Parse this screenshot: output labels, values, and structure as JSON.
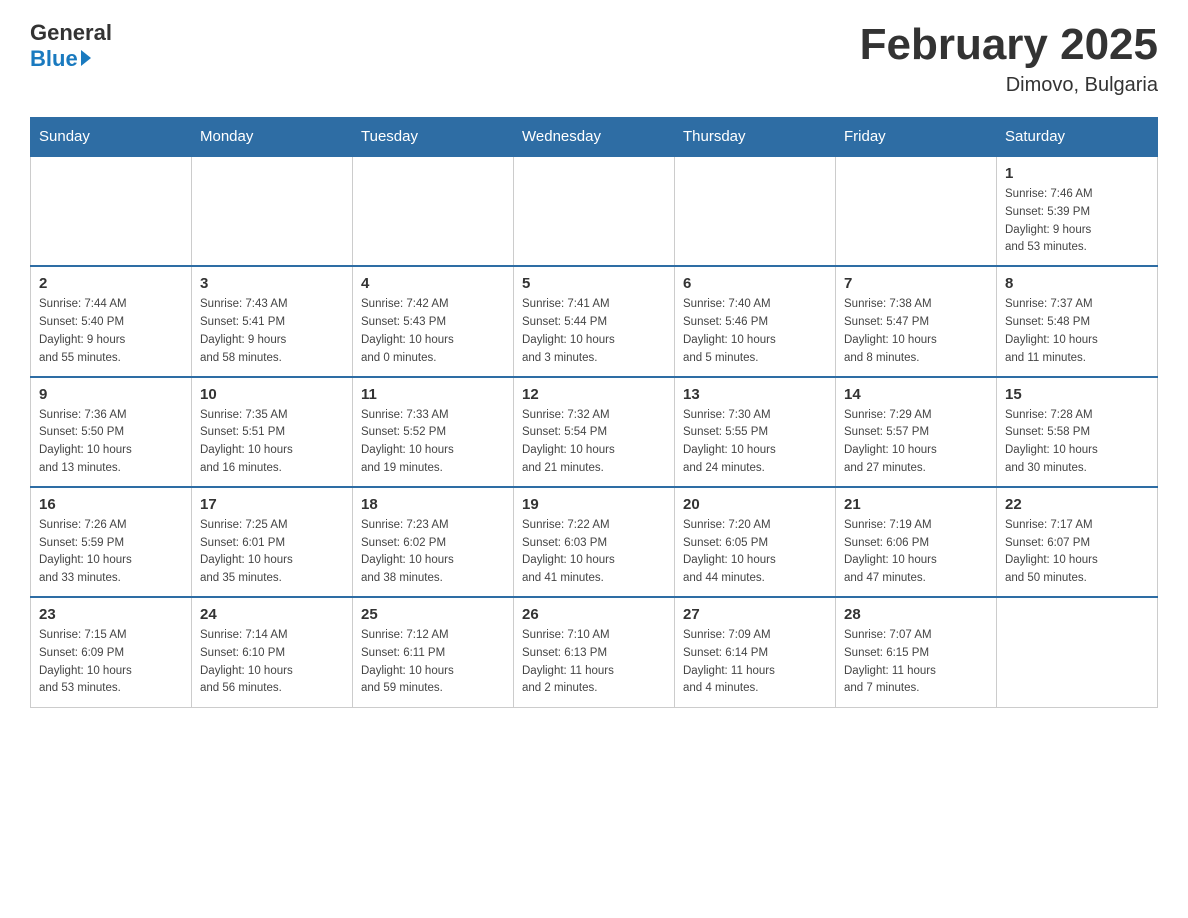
{
  "header": {
    "logo_general": "General",
    "logo_blue": "Blue",
    "month_title": "February 2025",
    "location": "Dimovo, Bulgaria"
  },
  "weekdays": [
    "Sunday",
    "Monday",
    "Tuesday",
    "Wednesday",
    "Thursday",
    "Friday",
    "Saturday"
  ],
  "weeks": [
    [
      {
        "day": "",
        "info": ""
      },
      {
        "day": "",
        "info": ""
      },
      {
        "day": "",
        "info": ""
      },
      {
        "day": "",
        "info": ""
      },
      {
        "day": "",
        "info": ""
      },
      {
        "day": "",
        "info": ""
      },
      {
        "day": "1",
        "info": "Sunrise: 7:46 AM\nSunset: 5:39 PM\nDaylight: 9 hours\nand 53 minutes."
      }
    ],
    [
      {
        "day": "2",
        "info": "Sunrise: 7:44 AM\nSunset: 5:40 PM\nDaylight: 9 hours\nand 55 minutes."
      },
      {
        "day": "3",
        "info": "Sunrise: 7:43 AM\nSunset: 5:41 PM\nDaylight: 9 hours\nand 58 minutes."
      },
      {
        "day": "4",
        "info": "Sunrise: 7:42 AM\nSunset: 5:43 PM\nDaylight: 10 hours\nand 0 minutes."
      },
      {
        "day": "5",
        "info": "Sunrise: 7:41 AM\nSunset: 5:44 PM\nDaylight: 10 hours\nand 3 minutes."
      },
      {
        "day": "6",
        "info": "Sunrise: 7:40 AM\nSunset: 5:46 PM\nDaylight: 10 hours\nand 5 minutes."
      },
      {
        "day": "7",
        "info": "Sunrise: 7:38 AM\nSunset: 5:47 PM\nDaylight: 10 hours\nand 8 minutes."
      },
      {
        "day": "8",
        "info": "Sunrise: 7:37 AM\nSunset: 5:48 PM\nDaylight: 10 hours\nand 11 minutes."
      }
    ],
    [
      {
        "day": "9",
        "info": "Sunrise: 7:36 AM\nSunset: 5:50 PM\nDaylight: 10 hours\nand 13 minutes."
      },
      {
        "day": "10",
        "info": "Sunrise: 7:35 AM\nSunset: 5:51 PM\nDaylight: 10 hours\nand 16 minutes."
      },
      {
        "day": "11",
        "info": "Sunrise: 7:33 AM\nSunset: 5:52 PM\nDaylight: 10 hours\nand 19 minutes."
      },
      {
        "day": "12",
        "info": "Sunrise: 7:32 AM\nSunset: 5:54 PM\nDaylight: 10 hours\nand 21 minutes."
      },
      {
        "day": "13",
        "info": "Sunrise: 7:30 AM\nSunset: 5:55 PM\nDaylight: 10 hours\nand 24 minutes."
      },
      {
        "day": "14",
        "info": "Sunrise: 7:29 AM\nSunset: 5:57 PM\nDaylight: 10 hours\nand 27 minutes."
      },
      {
        "day": "15",
        "info": "Sunrise: 7:28 AM\nSunset: 5:58 PM\nDaylight: 10 hours\nand 30 minutes."
      }
    ],
    [
      {
        "day": "16",
        "info": "Sunrise: 7:26 AM\nSunset: 5:59 PM\nDaylight: 10 hours\nand 33 minutes."
      },
      {
        "day": "17",
        "info": "Sunrise: 7:25 AM\nSunset: 6:01 PM\nDaylight: 10 hours\nand 35 minutes."
      },
      {
        "day": "18",
        "info": "Sunrise: 7:23 AM\nSunset: 6:02 PM\nDaylight: 10 hours\nand 38 minutes."
      },
      {
        "day": "19",
        "info": "Sunrise: 7:22 AM\nSunset: 6:03 PM\nDaylight: 10 hours\nand 41 minutes."
      },
      {
        "day": "20",
        "info": "Sunrise: 7:20 AM\nSunset: 6:05 PM\nDaylight: 10 hours\nand 44 minutes."
      },
      {
        "day": "21",
        "info": "Sunrise: 7:19 AM\nSunset: 6:06 PM\nDaylight: 10 hours\nand 47 minutes."
      },
      {
        "day": "22",
        "info": "Sunrise: 7:17 AM\nSunset: 6:07 PM\nDaylight: 10 hours\nand 50 minutes."
      }
    ],
    [
      {
        "day": "23",
        "info": "Sunrise: 7:15 AM\nSunset: 6:09 PM\nDaylight: 10 hours\nand 53 minutes."
      },
      {
        "day": "24",
        "info": "Sunrise: 7:14 AM\nSunset: 6:10 PM\nDaylight: 10 hours\nand 56 minutes."
      },
      {
        "day": "25",
        "info": "Sunrise: 7:12 AM\nSunset: 6:11 PM\nDaylight: 10 hours\nand 59 minutes."
      },
      {
        "day": "26",
        "info": "Sunrise: 7:10 AM\nSunset: 6:13 PM\nDaylight: 11 hours\nand 2 minutes."
      },
      {
        "day": "27",
        "info": "Sunrise: 7:09 AM\nSunset: 6:14 PM\nDaylight: 11 hours\nand 4 minutes."
      },
      {
        "day": "28",
        "info": "Sunrise: 7:07 AM\nSunset: 6:15 PM\nDaylight: 11 hours\nand 7 minutes."
      },
      {
        "day": "",
        "info": ""
      }
    ]
  ]
}
